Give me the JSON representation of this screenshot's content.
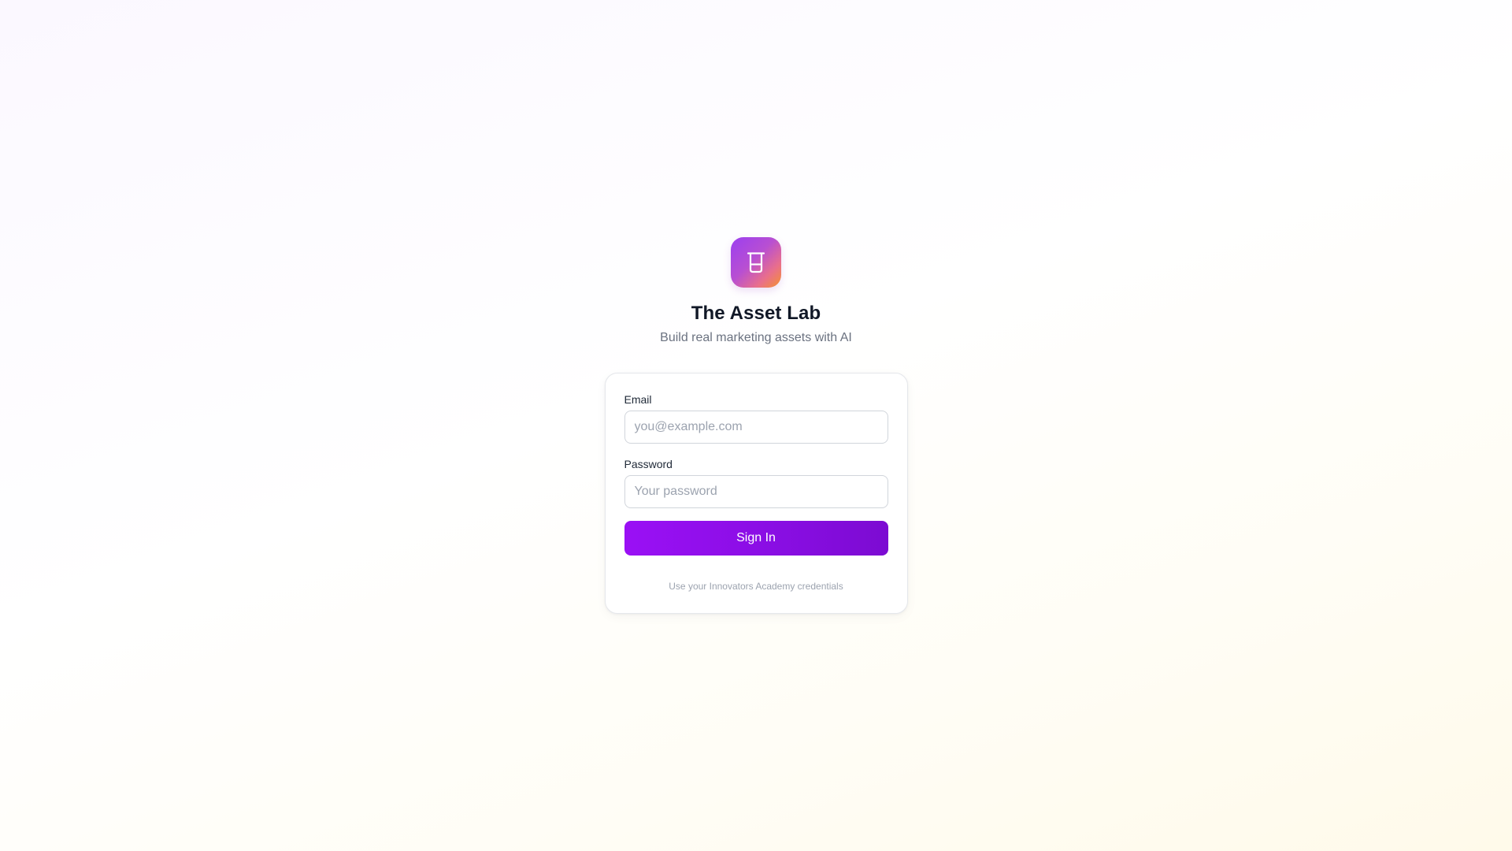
{
  "app": {
    "logo_icon": "beaker-icon",
    "title": "The Asset Lab",
    "subtitle": "Build real marketing assets with AI"
  },
  "login": {
    "email_label": "Email",
    "email_placeholder": "you@example.com",
    "email_value": "",
    "password_label": "Password",
    "password_placeholder": "Your password",
    "password_value": "",
    "submit_label": "Sign In",
    "hint": "Use your Innovators Academy credentials"
  },
  "colors": {
    "accent": "#8b0fe8",
    "logo_gradient_start": "#9b3ff0",
    "logo_gradient_end": "#f4922f"
  }
}
